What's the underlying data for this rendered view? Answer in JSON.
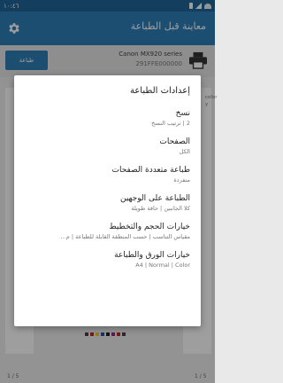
{
  "status_bar": {
    "time": "١٠:٤٦"
  },
  "app_bar": {
    "title": "معاينة قبل الطباعة",
    "settings_icon": "gear-icon"
  },
  "printer": {
    "name": "Canon MX920 series",
    "serial": "291FFE000000",
    "print_button_label": "طباعة",
    "icon": "printer-icon"
  },
  "preview": {
    "right_page_text": [
      "color",
      "y"
    ],
    "page_indicator_left": "1 / 5",
    "page_indicator_right": "1 / 5",
    "bar_colors": [
      "#444444",
      "#c62828",
      "#f4c430",
      "#2255aa",
      "#222222",
      "#8e2b8e",
      "#c62828",
      "#444444"
    ]
  },
  "dialog": {
    "title": "إعدادات الطباعة",
    "items": [
      {
        "title": "نسخ",
        "summary": "2 | ترتيب النسخ"
      },
      {
        "title": "الصفحات",
        "summary": "الكل"
      },
      {
        "title": "طباعة متعددة الصفحات",
        "summary": "منفردة"
      },
      {
        "title": "الطباعة على الوجهين",
        "summary": "كلا الجانبين | حافة طويلة"
      },
      {
        "title": "خيارات الحجم والتخطيط",
        "summary": "مقياس التناسب | حسب المنطقة القابلة للطباعة | م..."
      },
      {
        "title": "خيارات الورق والطباعة",
        "summary": "A4 | Normal | Color"
      }
    ]
  }
}
